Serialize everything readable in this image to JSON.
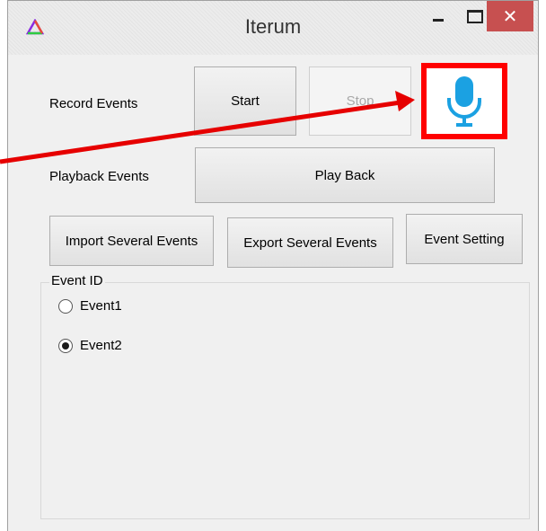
{
  "window": {
    "title": "Iterum",
    "close_glyph": "✕",
    "icons": [
      "app-icon",
      "minimize-icon",
      "maximize-icon",
      "close-icon"
    ]
  },
  "record": {
    "label": "Record Events",
    "start": "Start",
    "stop": "Stop"
  },
  "playback": {
    "label": "Playback Events",
    "button": "Play Back"
  },
  "actions": {
    "import": "Import Several Events",
    "export": "Export Several Events",
    "setting": "Event Setting"
  },
  "event_group": {
    "legend": "Event ID",
    "options": [
      {
        "label": "Event1",
        "selected": false
      },
      {
        "label": "Event2",
        "selected": true
      }
    ]
  },
  "annotation": {
    "highlight_icon": "microphone-icon",
    "highlight_color": "#ff0000",
    "mic_color": "#1ba1e2"
  }
}
